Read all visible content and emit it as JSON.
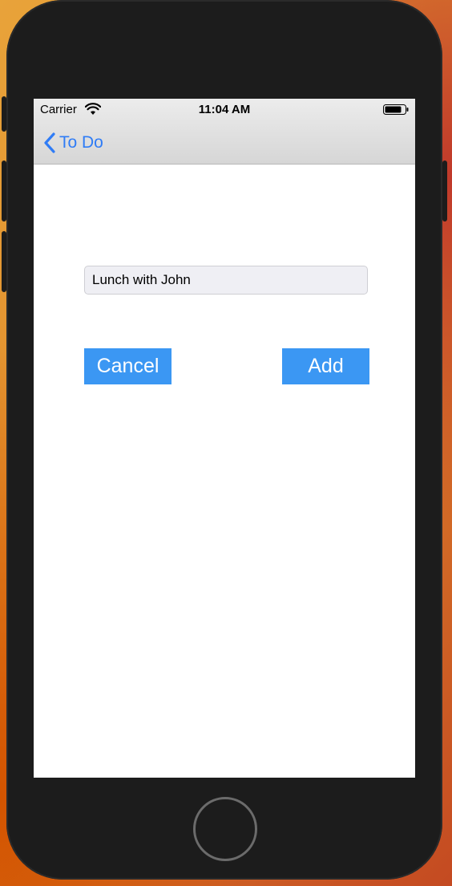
{
  "status_bar": {
    "carrier": "Carrier",
    "time": "11:04 AM",
    "icons": [
      "wifi-icon",
      "battery-icon"
    ]
  },
  "nav_bar": {
    "back_label": "To Do",
    "back_icon": "chevron-left-icon"
  },
  "form": {
    "task_value": "Lunch with John",
    "cancel_label": "Cancel",
    "add_label": "Add"
  },
  "colors": {
    "accent": "#2f7cf6",
    "button_bg": "#3b97f3",
    "button_text": "#ffffff",
    "device_body": "#1c1c1c"
  }
}
